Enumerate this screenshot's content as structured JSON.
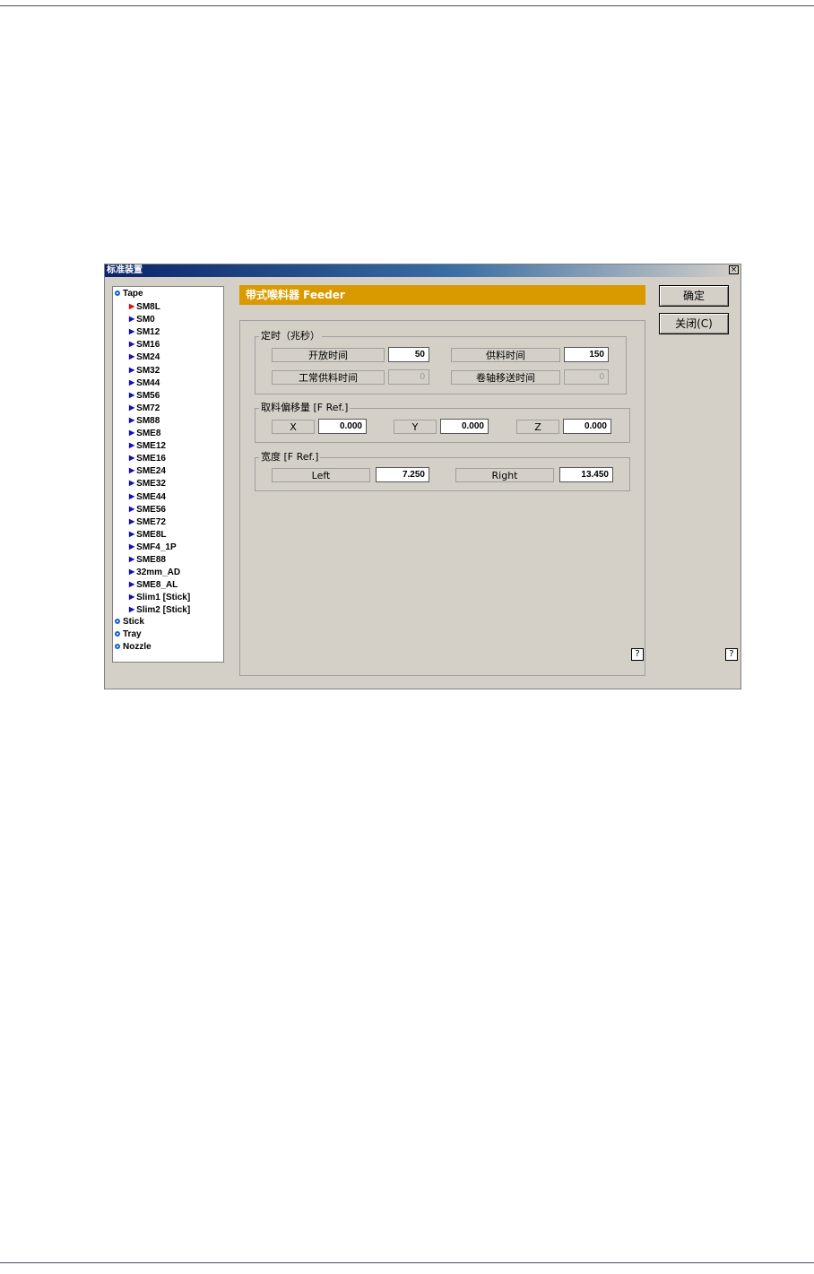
{
  "dialog": {
    "title": "标准装置",
    "close_glyph": "×",
    "header": "带式喉料器 Feeder",
    "ok_label": "确定",
    "close_label": "关闭(C)",
    "help_label": "?"
  },
  "tree": {
    "tape": "Tape",
    "tape_items": [
      "SM8L",
      "SM0",
      "SM12",
      "SM16",
      "SM24",
      "SM32",
      "SM44",
      "SM56",
      "SM72",
      "SM88",
      "SME8",
      "SME12",
      "SME16",
      "SME24",
      "SME32",
      "SME44",
      "SME56",
      "SME72",
      "SME8L",
      "SMF4_1P",
      "SME88",
      "32mm_AD",
      "SME8_AL",
      "Slim1 [Stick]",
      "Slim2 [Stick]"
    ],
    "selected": "SM8L",
    "stick": "Stick",
    "tray": "Tray",
    "nozzle": "Nozzle"
  },
  "timing": {
    "title": "定时（兆秒）",
    "open_label": "开放时间",
    "open_value": "50",
    "feed_label": "供料时间",
    "feed_value": "150",
    "normal_label": "工常供料时间",
    "normal_value": "0",
    "reel_label": "卷轴移送时间",
    "reel_value": "0"
  },
  "offset": {
    "title": "取料偏移量 [F Ref.]",
    "x_label": "X",
    "x_value": "0.000",
    "y_label": "Y",
    "y_value": "0.000",
    "z_label": "Z",
    "z_value": "0.000"
  },
  "width": {
    "title": "宽度 [F Ref.]",
    "left_label": "Left",
    "left_value": "7.250",
    "right_label": "Right",
    "right_value": "13.450"
  },
  "colors": {
    "header": "#d99a00",
    "title_bar": "#0a246a",
    "selected_arrow": "#e01010",
    "arrow": "#1010c0"
  }
}
